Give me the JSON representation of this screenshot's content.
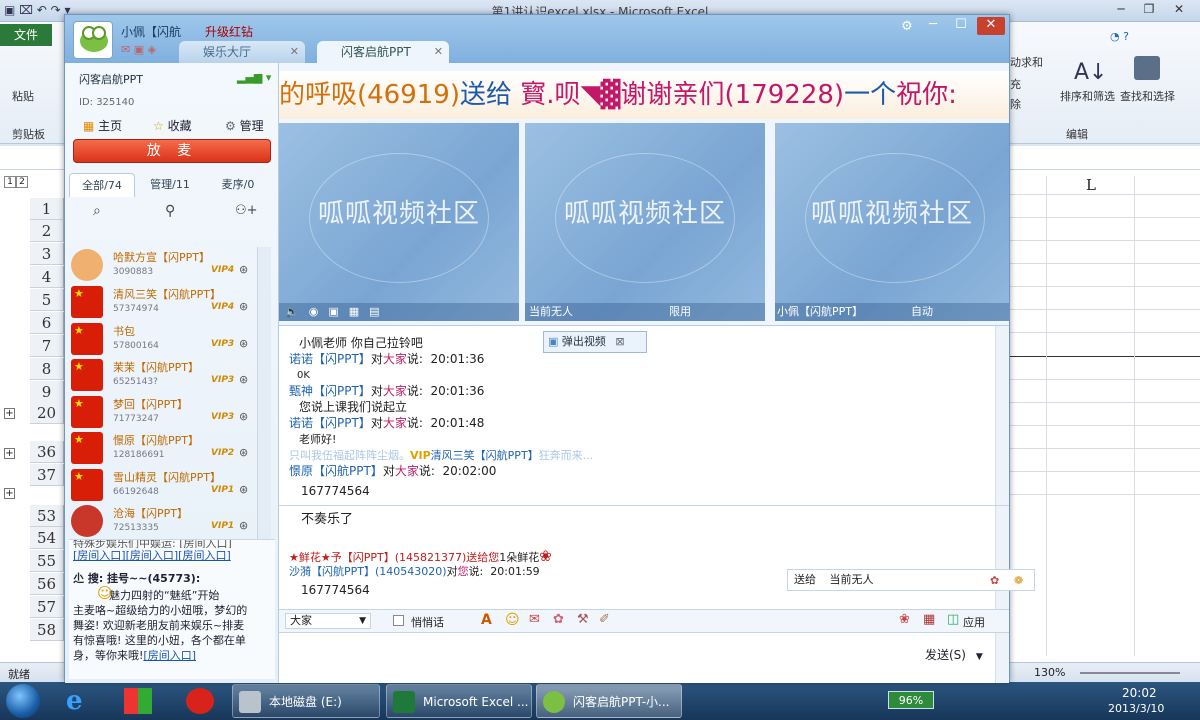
{
  "excel": {
    "title": "第1讲认识excel.xlsx - Microsoft Excel",
    "file_tab": "文件",
    "paste": "粘贴",
    "clipboard": "剪贴板",
    "editing": "编辑",
    "sort_filter": "排序和筛选",
    "find_select": "查找和选择",
    "autosum": "动求和",
    "fill": "充",
    "clear": "除",
    "col_L": "L",
    "outline_levels": [
      "1",
      "2"
    ],
    "rows": [
      "1",
      "2",
      "3",
      "4",
      "5",
      "6",
      "7",
      "8",
      "9",
      "20",
      "36",
      "37",
      "53",
      "54",
      "55",
      "56",
      "57",
      "58"
    ],
    "status_ready": "就绪",
    "zoom": "130%"
  },
  "qq": {
    "nick": "小佩【闪航",
    "upgrade": "升级红钻",
    "tabs": [
      {
        "label": "娱乐大厅"
      },
      {
        "label": "闪客启航PPT"
      }
    ],
    "room": {
      "name": "闪客启航PPT",
      "id": "ID: 325140"
    },
    "nav": [
      "主页",
      "收藏",
      "管理"
    ],
    "fangmai": "放 麦",
    "list_tabs": [
      "全部/74",
      "管理/11",
      "麦序/0"
    ],
    "users": [
      {
        "name": "哈默方宣【闪PPT】",
        "id": "3090883",
        "vip": "VIP4"
      },
      {
        "name": "清风三笑【闪航PPT】",
        "id": "57374974",
        "vip": "VIP4"
      },
      {
        "name": "书包",
        "id": "57800164",
        "vip": "VIP3"
      },
      {
        "name": "茉茉【闪航PPT】",
        "id": "6525143?",
        "vip": "VIP3"
      },
      {
        "name": "梦回【闪PPT】",
        "id": "71773247",
        "vip": "VIP3"
      },
      {
        "name": "憬原【闪航PPT】",
        "id": "128186691",
        "vip": "VIP2"
      },
      {
        "name": "雪山精灵【闪航PPT】",
        "id": "66192648",
        "vip": "VIP1"
      },
      {
        "name": "沧海【闪PPT】",
        "id": "72513335",
        "vip": "VIP1"
      }
    ],
    "announcement": {
      "line0": "特殊步娱乐们中娱运: [房间入口]",
      "links": "[房间入口][房间入口][房间入口]",
      "title": "尐 搜: 挂号~~(45773):",
      "body1": "魅力四射的“魅纸”开始",
      "body2": "主麦咯~超级给力的小妞哦，梦幻的",
      "body3": "舞姿! 欢迎新老朋友前来娱乐~排麦",
      "body4": "有惊喜哦! 这里的小妞，各个都在单",
      "body5": "身，等你来哦!",
      "link_last": "[房间入口]"
    },
    "marquee": {
      "a": "的呼吸(46919)",
      "b": "送给",
      "c": "寳.呗◥▓谢谢亲们(179228)",
      "d": "一个",
      "e": "祝你:"
    },
    "video": [
      {
        "watermark": "呱呱视频社区",
        "status": ""
      },
      {
        "watermark": "呱呱视频社区",
        "status": "当前无人",
        "mode": "限用"
      },
      {
        "watermark": "呱呱视频社区",
        "status": "小佩【闪航PPT】",
        "mode": "自动"
      }
    ],
    "popup_video": "弹出视频",
    "chat": [
      {
        "who": "小佩老师 你自己拉铃吧"
      },
      {
        "who": "诺诺【闪PPT】",
        "to": "对",
        "all": "大家",
        "say": "说:",
        "time": "20:01:36"
      },
      {
        "msg": "0K"
      },
      {
        "who": "甄神【闪PPT】",
        "to": "对",
        "all": "大家",
        "say": "说:",
        "time": "20:01:36"
      },
      {
        "msg": "您说上课我们说起立"
      },
      {
        "who": "诺诺【闪PPT】",
        "to": "对",
        "all": "大家",
        "say": "说:",
        "time": "20:01:48"
      },
      {
        "msg": "老师好!"
      },
      {
        "sys_a": "只叫我伍福起阵阵尘烟。",
        "vip": "VIP",
        "sys_b": "清风三笑【闪航PPT】",
        "sys_c": "狂奔而来..."
      },
      {
        "who": "憬原【闪航PPT】",
        "to": "对",
        "all": "大家",
        "say": "说:",
        "time": "20:02:00"
      },
      {
        "msg": "167774564"
      }
    ],
    "chat2": {
      "l1": "不奏乐了",
      "gift_a": "★鲜花★予【闪PPT】(145821377)",
      "gift_b": "送给您",
      "gift_c": "1朵鲜花",
      "l3_who": "沙漪【闪航PPT】(140543020)",
      "l3_to": "对",
      "l3_you": "您",
      "l3_say": "说:",
      "l3_time": "20:01:59",
      "l4": "167774564"
    },
    "send_to_label": "送给",
    "send_to_value": "当前无人",
    "input_target": "大家",
    "whisper": "悄悄话",
    "app": "应用",
    "send": "发送(S)"
  },
  "taskbar": {
    "items": [
      "本地磁盘 (E:)",
      "Microsoft Excel ...",
      "闪客启航PPT-小..."
    ],
    "battery": "96%",
    "time": "20:02",
    "date": "2013/3/10"
  }
}
